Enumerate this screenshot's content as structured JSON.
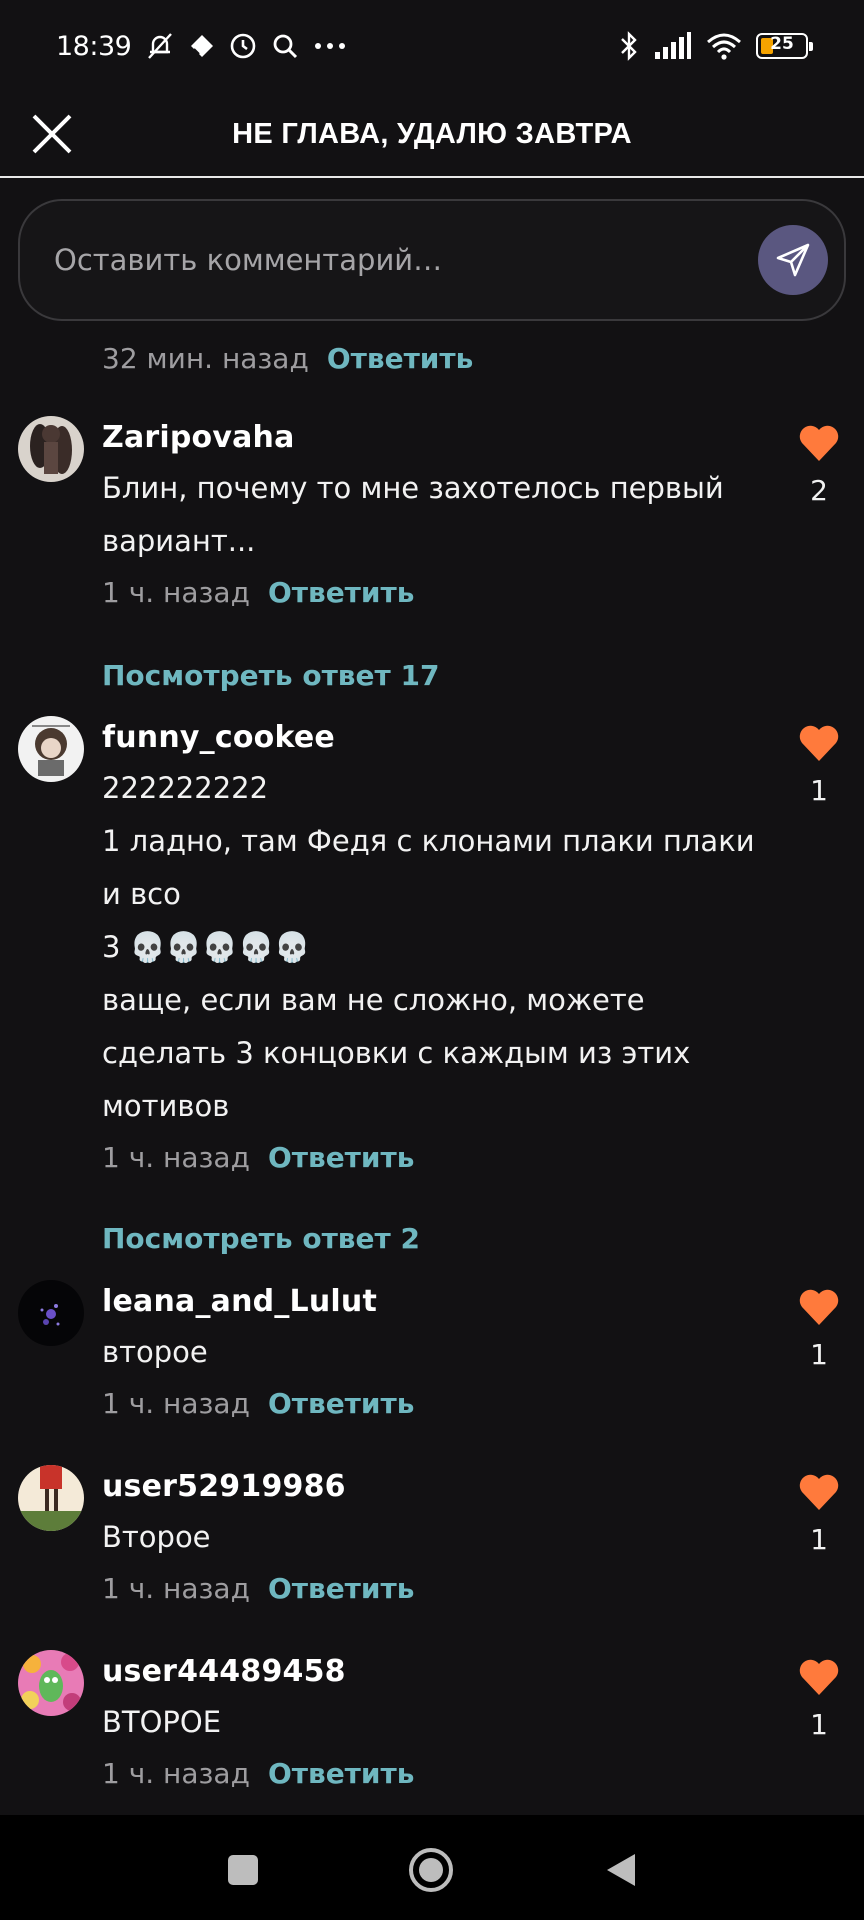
{
  "status_bar": {
    "time": "18:39",
    "battery_level": "25",
    "icons": [
      "muted-bell-icon",
      "diamond-icon",
      "clock-icon",
      "search-icon",
      "more-dots-icon",
      "bluetooth-icon",
      "signal-icon",
      "wifi-icon",
      "battery-icon"
    ]
  },
  "header": {
    "title": "НЕ ГЛАВА, УДАЛЮ ЗАВТРА",
    "close_icon": "close-icon"
  },
  "comment_input": {
    "placeholder": "Оставить комментарий…",
    "send_icon": "send-icon"
  },
  "previous": {
    "time": "32 мин. назад",
    "reply": "Ответить"
  },
  "comments": [
    {
      "username": "Zaripovaha",
      "text": "Блин, почему то мне захотелось первый\nвариант...",
      "time": "1 ч. назад",
      "reply": "Ответить",
      "likes": "2",
      "view_replies": "Посмотреть ответ 17"
    },
    {
      "username": "funny_cookee",
      "text": "222222222\n1 ладно, там Федя с клонами плаки плаки\nи всо\n3 💀💀💀💀💀\nваще, если вам не сложно, можете\nсделать 3 концовки с каждым из этих\nмотивов",
      "time": "1 ч. назад",
      "reply": "Ответить",
      "likes": "1",
      "view_replies": "Посмотреть ответ 2"
    },
    {
      "username": "leana_and_Lulut",
      "text": "второе",
      "time": "1 ч. назад",
      "reply": "Ответить",
      "likes": "1"
    },
    {
      "username": "user52919986",
      "text": "Второе",
      "time": "1 ч. назад",
      "reply": "Ответить",
      "likes": "1"
    },
    {
      "username": "user44489458",
      "text": "ВТОРОЕ",
      "time": "1 ч. назад",
      "reply": "Ответить",
      "likes": "1"
    }
  ],
  "colors": {
    "background": "#121113",
    "accent_link": "#6fb7c0",
    "like_heart": "#ff7a3c",
    "send_button": "#5a5780"
  }
}
